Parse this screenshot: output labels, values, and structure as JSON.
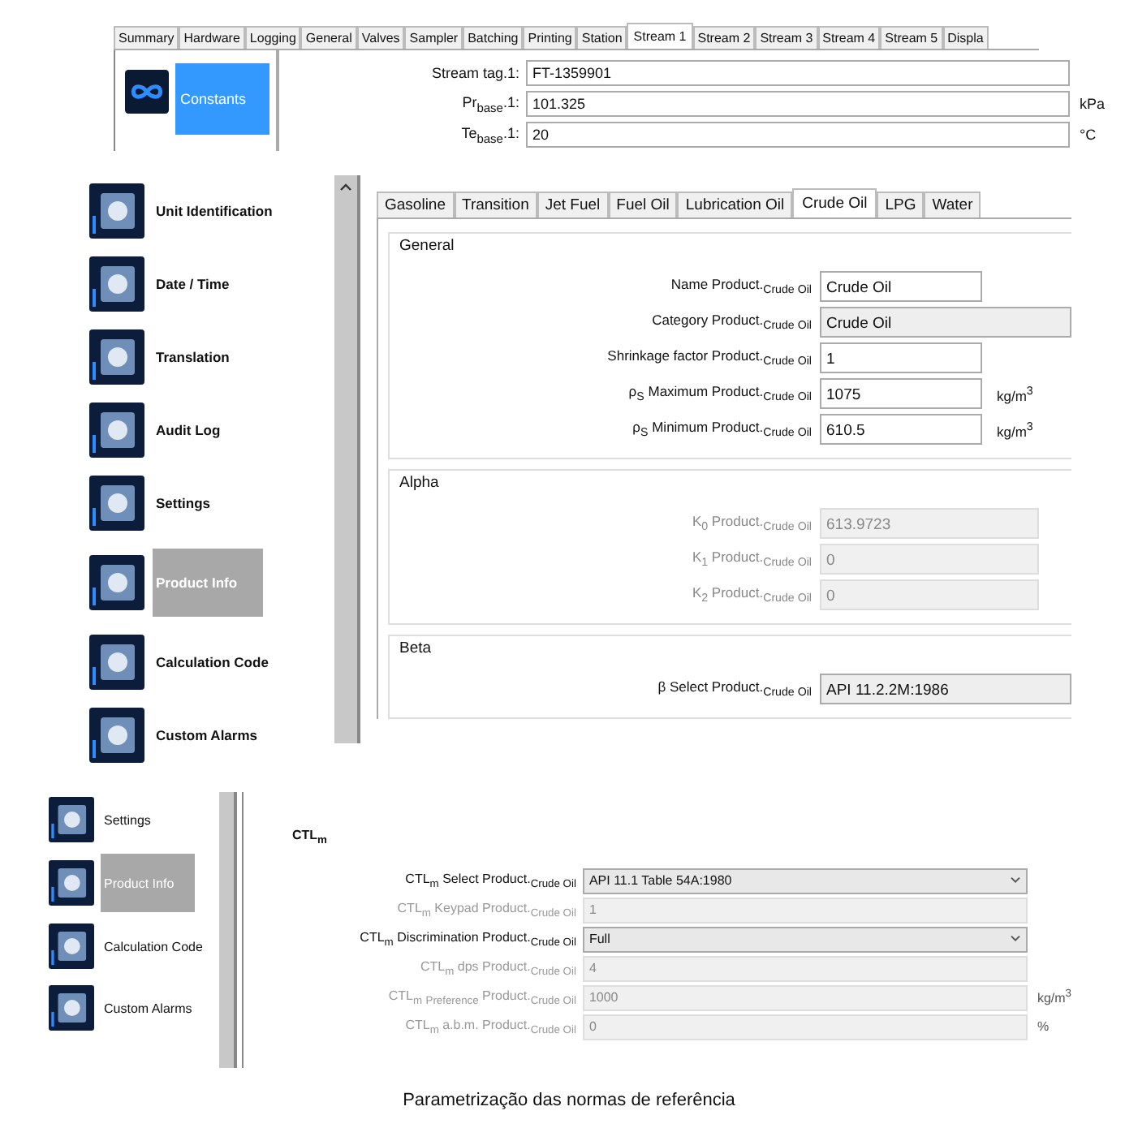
{
  "stream_window": {
    "tabs": [
      {
        "label": "Summary",
        "selected": false
      },
      {
        "label": "Hardware",
        "selected": false
      },
      {
        "label": "Logging",
        "selected": false
      },
      {
        "label": "General",
        "selected": false
      },
      {
        "label": "Valves",
        "selected": false
      },
      {
        "label": "Sampler",
        "selected": false
      },
      {
        "label": "Batching",
        "selected": false
      },
      {
        "label": "Printing",
        "selected": false
      },
      {
        "label": "Station",
        "selected": false
      },
      {
        "label": "Stream 1",
        "selected": true
      },
      {
        "label": "Stream 2",
        "selected": false
      },
      {
        "label": "Stream 3",
        "selected": false
      },
      {
        "label": "Stream 4",
        "selected": false
      },
      {
        "label": "Stream 5",
        "selected": false
      },
      {
        "label": "Displa",
        "selected": false
      }
    ],
    "sidebar": [
      {
        "label": "Constants",
        "selected": true
      }
    ],
    "fields": [
      {
        "label": "Stream tag.1:",
        "value": "FT-1359901"
      },
      {
        "label": "Pr$_{base}$.1:",
        "value": "101.325",
        "unit": "kPa"
      },
      {
        "label": "Te$_{base}$.1:",
        "value": "20",
        "unit": "°C"
      }
    ]
  },
  "product_window": {
    "sidebar": [
      {
        "label": "Unit Identification",
        "selected": false
      },
      {
        "label": "Date / Time",
        "selected": false
      },
      {
        "label": "Translation",
        "selected": false
      },
      {
        "label": "Audit Log",
        "selected": false
      },
      {
        "label": "Settings",
        "selected": false
      },
      {
        "label": "Product Info",
        "selected": true
      },
      {
        "label": "Calculation Code",
        "selected": false
      },
      {
        "label": "Custom Alarms",
        "selected": false
      }
    ],
    "tabs": [
      {
        "label": "Gasoline",
        "selected": false
      },
      {
        "label": "Transition",
        "selected": false
      },
      {
        "label": "Jet Fuel",
        "selected": false
      },
      {
        "label": "Fuel Oil",
        "selected": false
      },
      {
        "label": "Lubrication Oil",
        "selected": false
      },
      {
        "label": "Crude Oil",
        "selected": true
      },
      {
        "label": "LPG",
        "selected": false
      },
      {
        "label": "Water",
        "selected": false
      }
    ],
    "groups": [
      {
        "title": "General",
        "fields": [
          {
            "label": "Name Product.$_{Crude Oil}$",
            "value": "Crude Oil",
            "kind": "input"
          },
          {
            "label": "Category Product.$_{Crude Oil}$",
            "value": "Crude Oil",
            "kind": "combo"
          },
          {
            "label": "Shrinkage factor Product.$_{Crude Oil}$",
            "value": "1",
            "kind": "input"
          },
          {
            "label": "ρ$_{S}$ Maximum Product.$_{Crude Oil}$",
            "value": "1075",
            "unit": "kg/m$^{3}$",
            "kind": "input"
          },
          {
            "label": "ρ$_{S}$ Minimum Product.$_{Crude Oil}$",
            "value": "610.5",
            "unit": "kg/m$^{3}$",
            "kind": "input"
          }
        ]
      },
      {
        "title": "Alpha",
        "fields": [
          {
            "label": "K$_{0}$ Product.$_{Crude Oil}$",
            "value": "613.9723",
            "kind": "readonly"
          },
          {
            "label": "K$_{1}$ Product.$_{Crude Oil}$",
            "value": "0",
            "kind": "readonly"
          },
          {
            "label": "K$_{2}$ Product.$_{Crude Oil}$",
            "value": "0",
            "kind": "readonly"
          }
        ]
      },
      {
        "title": "Beta",
        "fields": [
          {
            "label": "β Select Product.$_{Crude Oil}$",
            "value": "API 11.2.2M:1986",
            "kind": "combo"
          }
        ]
      }
    ]
  },
  "ctl_window": {
    "sidebar": [
      {
        "label": "Settings",
        "selected": false
      },
      {
        "label": "Product Info",
        "selected": true
      },
      {
        "label": "Calculation Code",
        "selected": false
      },
      {
        "label": "Custom Alarms",
        "selected": false
      }
    ],
    "section_title": "CTL$_{m}$",
    "fields": [
      {
        "label": "CTL$_{m}$ Select Product.$_{Crude Oil}$",
        "value": "API 11.1 Table 54A:1980",
        "kind": "dropdown"
      },
      {
        "label": "CTL$_{m}$ Keypad Product.$_{Crude Oil}$",
        "value": "1",
        "kind": "readonly"
      },
      {
        "label": "CTL$_{m}$ Discrimination Product.$_{Crude Oil}$",
        "value": "Full",
        "kind": "dropdown"
      },
      {
        "label": "CTL$_{m}$ dps Product.$_{Crude Oil}$",
        "value": "4",
        "kind": "readonly"
      },
      {
        "label": "CTL$_{m}$ $_{Preference}$ Product.$_{Crude Oil}$",
        "value": "1000",
        "unit": "kg/m$^{3}$",
        "kind": "readonly"
      },
      {
        "label": "CTL$_{m}$ a.b.m. Product.$_{Crude Oil}$",
        "value": "0",
        "unit": "%",
        "kind": "readonly"
      }
    ]
  },
  "caption": "Parametrização das normas de referência"
}
